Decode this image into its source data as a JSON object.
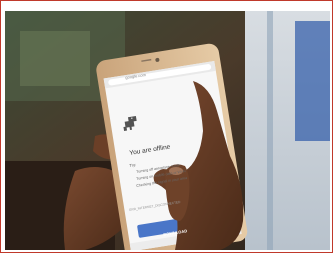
{
  "phone_screen": {
    "url": "google.com",
    "heading": "You are offline",
    "try_label": "Try:",
    "suggestions": [
      "Turning off aeroplane mode",
      "Turning on mobile data or Wi-Fi",
      "Checking the signal in your area"
    ],
    "error_code": "ERR_INTERNET_DISCONNECTED",
    "download_label": "DOWNLOAD"
  },
  "colors": {
    "frame_border": "#c0392b",
    "download_button": "#4a76c8",
    "dino": "#535353"
  }
}
